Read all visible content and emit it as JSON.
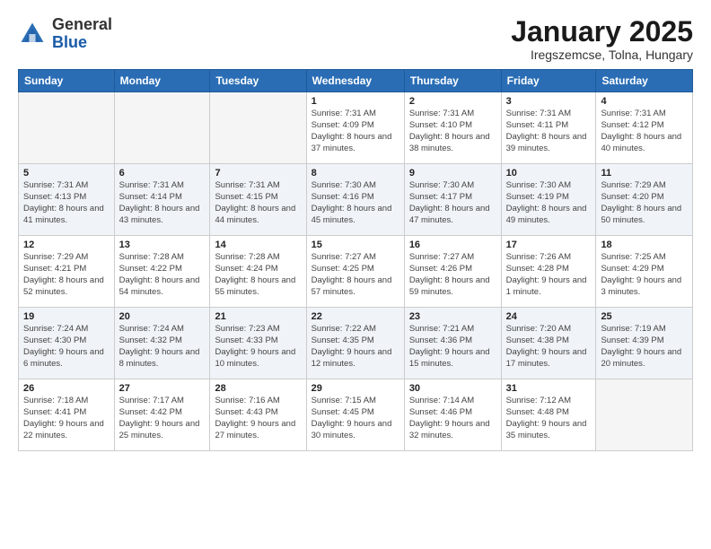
{
  "header": {
    "logo_general": "General",
    "logo_blue": "Blue",
    "month_title": "January 2025",
    "location": "Iregszemcse, Tolna, Hungary"
  },
  "weekdays": [
    "Sunday",
    "Monday",
    "Tuesday",
    "Wednesday",
    "Thursday",
    "Friday",
    "Saturday"
  ],
  "weeks": [
    [
      {
        "day": "",
        "info": ""
      },
      {
        "day": "",
        "info": ""
      },
      {
        "day": "",
        "info": ""
      },
      {
        "day": "1",
        "info": "Sunrise: 7:31 AM\nSunset: 4:09 PM\nDaylight: 8 hours and 37 minutes."
      },
      {
        "day": "2",
        "info": "Sunrise: 7:31 AM\nSunset: 4:10 PM\nDaylight: 8 hours and 38 minutes."
      },
      {
        "day": "3",
        "info": "Sunrise: 7:31 AM\nSunset: 4:11 PM\nDaylight: 8 hours and 39 minutes."
      },
      {
        "day": "4",
        "info": "Sunrise: 7:31 AM\nSunset: 4:12 PM\nDaylight: 8 hours and 40 minutes."
      }
    ],
    [
      {
        "day": "5",
        "info": "Sunrise: 7:31 AM\nSunset: 4:13 PM\nDaylight: 8 hours and 41 minutes."
      },
      {
        "day": "6",
        "info": "Sunrise: 7:31 AM\nSunset: 4:14 PM\nDaylight: 8 hours and 43 minutes."
      },
      {
        "day": "7",
        "info": "Sunrise: 7:31 AM\nSunset: 4:15 PM\nDaylight: 8 hours and 44 minutes."
      },
      {
        "day": "8",
        "info": "Sunrise: 7:30 AM\nSunset: 4:16 PM\nDaylight: 8 hours and 45 minutes."
      },
      {
        "day": "9",
        "info": "Sunrise: 7:30 AM\nSunset: 4:17 PM\nDaylight: 8 hours and 47 minutes."
      },
      {
        "day": "10",
        "info": "Sunrise: 7:30 AM\nSunset: 4:19 PM\nDaylight: 8 hours and 49 minutes."
      },
      {
        "day": "11",
        "info": "Sunrise: 7:29 AM\nSunset: 4:20 PM\nDaylight: 8 hours and 50 minutes."
      }
    ],
    [
      {
        "day": "12",
        "info": "Sunrise: 7:29 AM\nSunset: 4:21 PM\nDaylight: 8 hours and 52 minutes."
      },
      {
        "day": "13",
        "info": "Sunrise: 7:28 AM\nSunset: 4:22 PM\nDaylight: 8 hours and 54 minutes."
      },
      {
        "day": "14",
        "info": "Sunrise: 7:28 AM\nSunset: 4:24 PM\nDaylight: 8 hours and 55 minutes."
      },
      {
        "day": "15",
        "info": "Sunrise: 7:27 AM\nSunset: 4:25 PM\nDaylight: 8 hours and 57 minutes."
      },
      {
        "day": "16",
        "info": "Sunrise: 7:27 AM\nSunset: 4:26 PM\nDaylight: 8 hours and 59 minutes."
      },
      {
        "day": "17",
        "info": "Sunrise: 7:26 AM\nSunset: 4:28 PM\nDaylight: 9 hours and 1 minute."
      },
      {
        "day": "18",
        "info": "Sunrise: 7:25 AM\nSunset: 4:29 PM\nDaylight: 9 hours and 3 minutes."
      }
    ],
    [
      {
        "day": "19",
        "info": "Sunrise: 7:24 AM\nSunset: 4:30 PM\nDaylight: 9 hours and 6 minutes."
      },
      {
        "day": "20",
        "info": "Sunrise: 7:24 AM\nSunset: 4:32 PM\nDaylight: 9 hours and 8 minutes."
      },
      {
        "day": "21",
        "info": "Sunrise: 7:23 AM\nSunset: 4:33 PM\nDaylight: 9 hours and 10 minutes."
      },
      {
        "day": "22",
        "info": "Sunrise: 7:22 AM\nSunset: 4:35 PM\nDaylight: 9 hours and 12 minutes."
      },
      {
        "day": "23",
        "info": "Sunrise: 7:21 AM\nSunset: 4:36 PM\nDaylight: 9 hours and 15 minutes."
      },
      {
        "day": "24",
        "info": "Sunrise: 7:20 AM\nSunset: 4:38 PM\nDaylight: 9 hours and 17 minutes."
      },
      {
        "day": "25",
        "info": "Sunrise: 7:19 AM\nSunset: 4:39 PM\nDaylight: 9 hours and 20 minutes."
      }
    ],
    [
      {
        "day": "26",
        "info": "Sunrise: 7:18 AM\nSunset: 4:41 PM\nDaylight: 9 hours and 22 minutes."
      },
      {
        "day": "27",
        "info": "Sunrise: 7:17 AM\nSunset: 4:42 PM\nDaylight: 9 hours and 25 minutes."
      },
      {
        "day": "28",
        "info": "Sunrise: 7:16 AM\nSunset: 4:43 PM\nDaylight: 9 hours and 27 minutes."
      },
      {
        "day": "29",
        "info": "Sunrise: 7:15 AM\nSunset: 4:45 PM\nDaylight: 9 hours and 30 minutes."
      },
      {
        "day": "30",
        "info": "Sunrise: 7:14 AM\nSunset: 4:46 PM\nDaylight: 9 hours and 32 minutes."
      },
      {
        "day": "31",
        "info": "Sunrise: 7:12 AM\nSunset: 4:48 PM\nDaylight: 9 hours and 35 minutes."
      },
      {
        "day": "",
        "info": ""
      }
    ]
  ]
}
